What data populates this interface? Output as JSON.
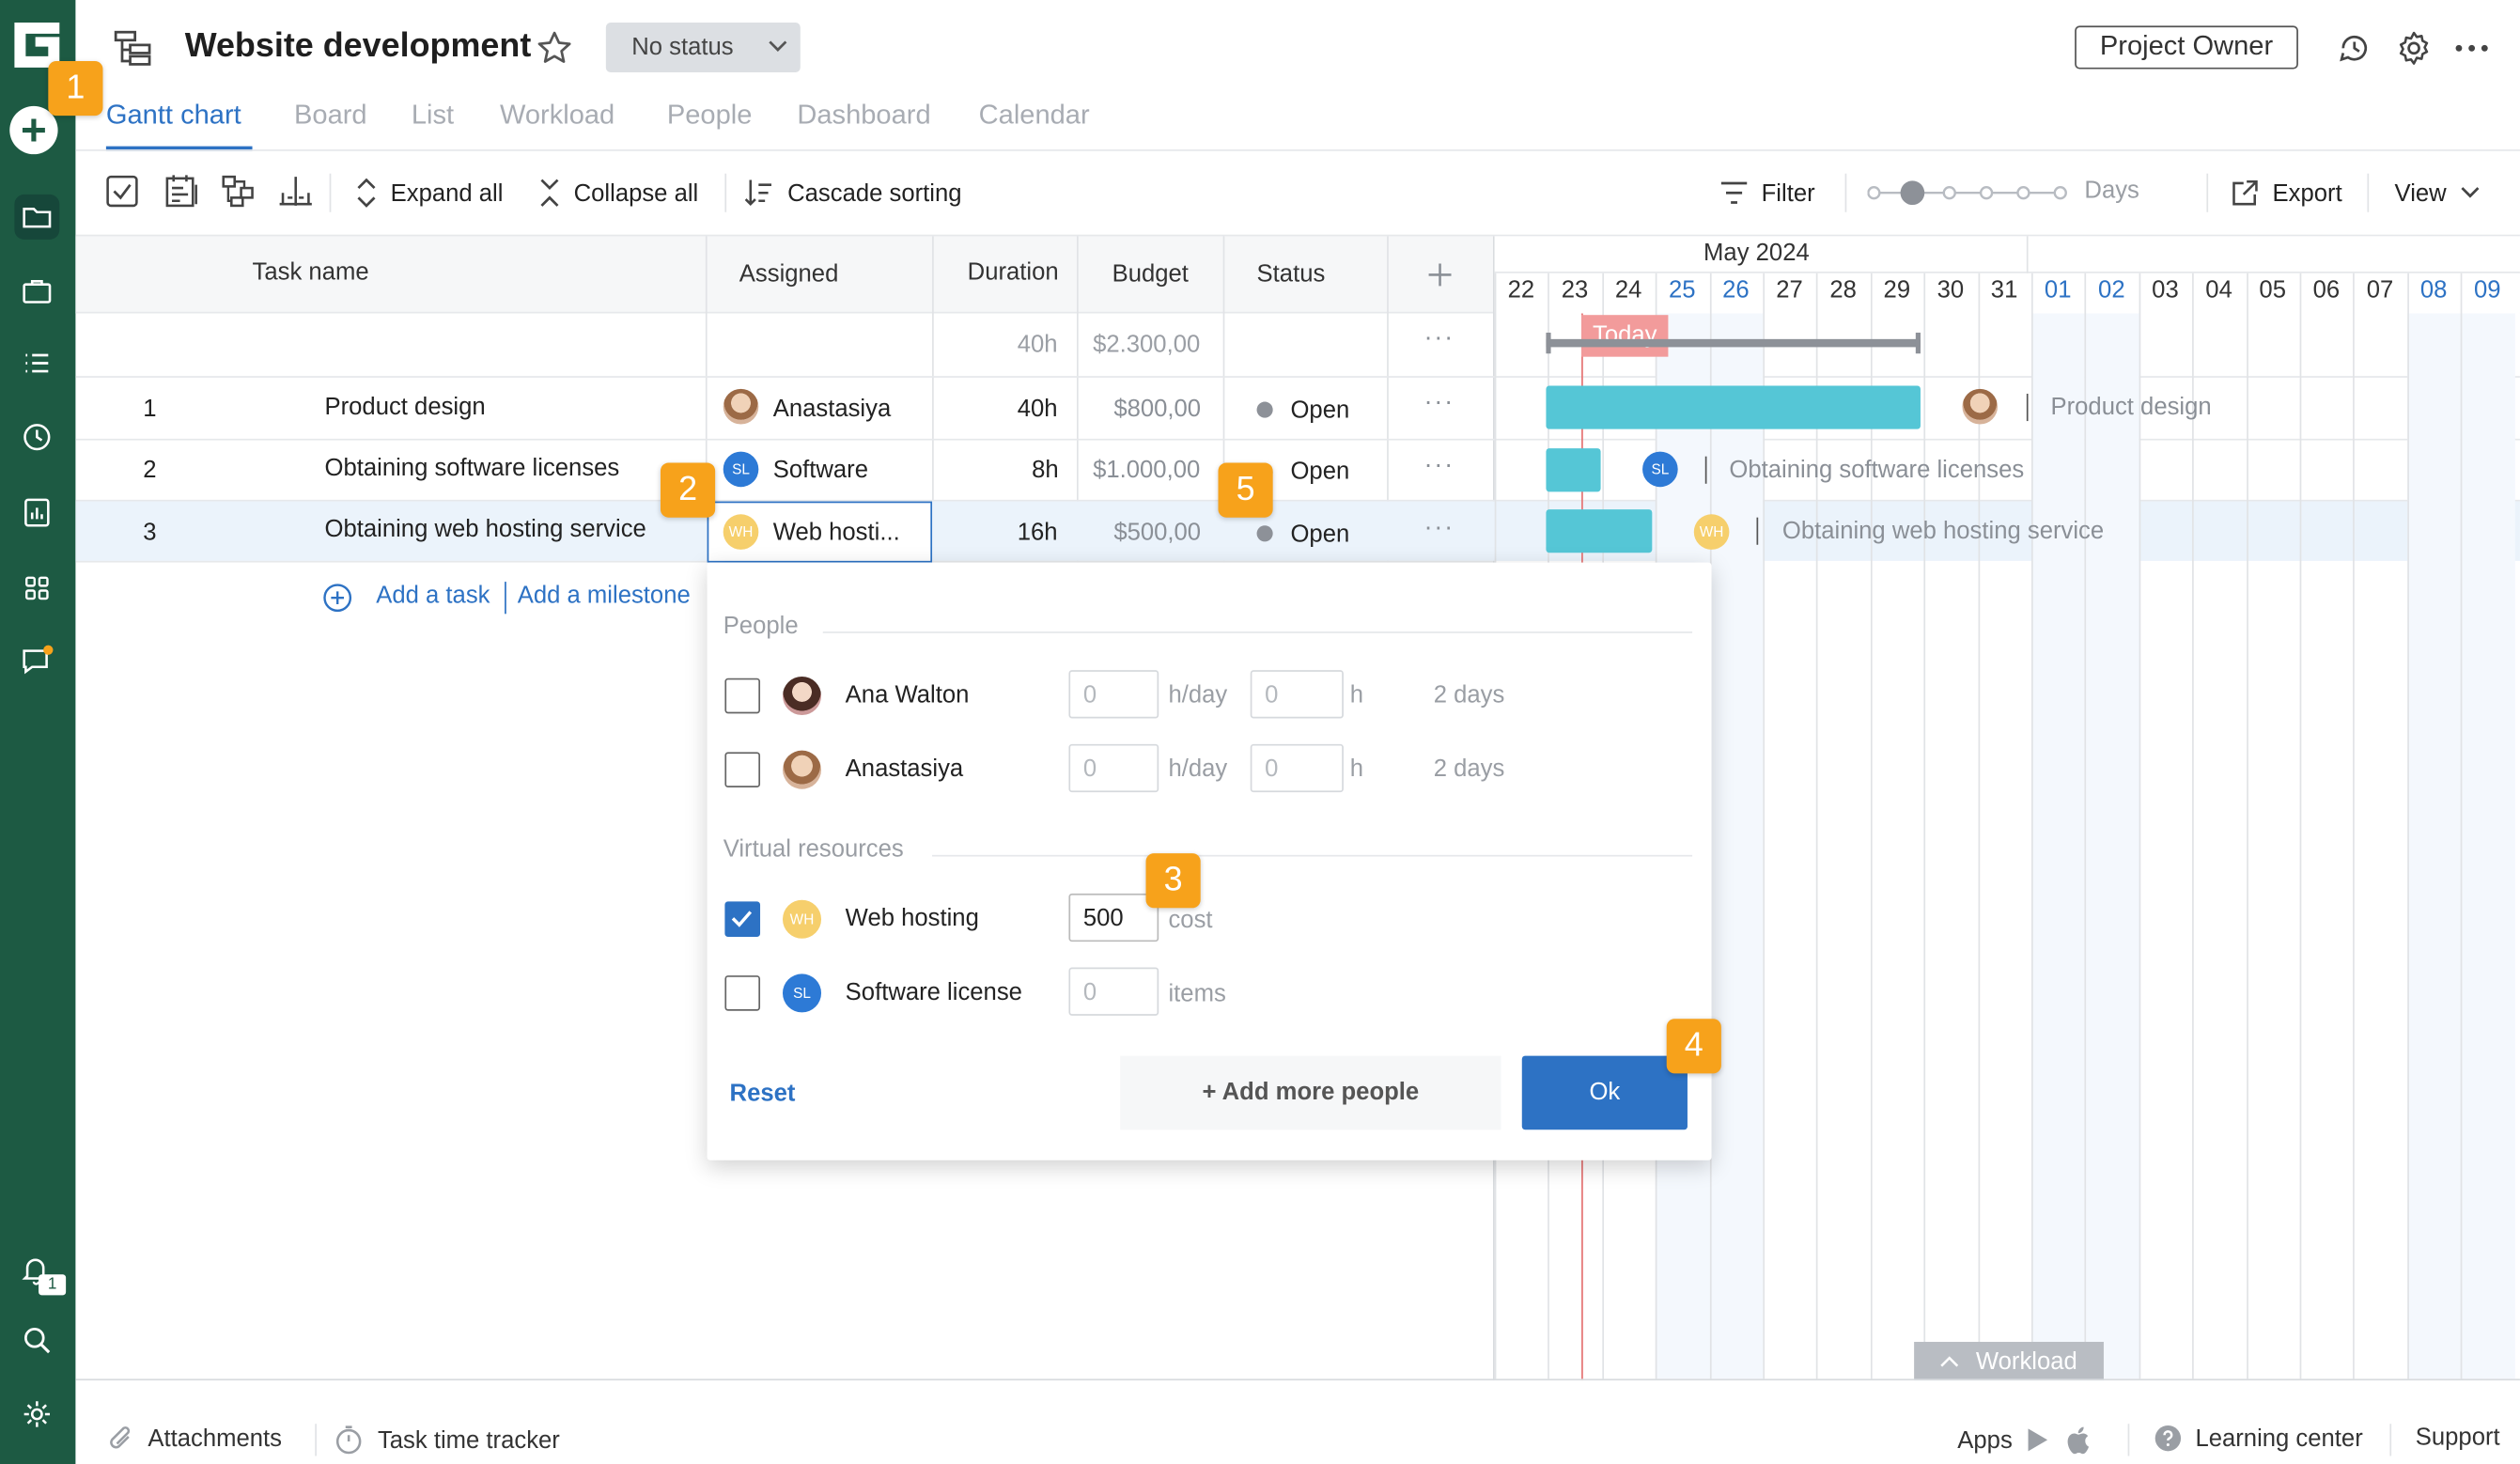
{
  "header": {
    "project_title": "Website development",
    "status_select": "No status",
    "role_button": "Project Owner"
  },
  "tabs": [
    "Gantt chart",
    "Board",
    "List",
    "Workload",
    "People",
    "Dashboard",
    "Calendar"
  ],
  "active_tab": "Gantt chart",
  "toolbar": {
    "expand_all": "Expand all",
    "collapse_all": "Collapse all",
    "cascade_sorting": "Cascade sorting",
    "filter": "Filter",
    "zoom_label": "Days",
    "export": "Export",
    "view": "View"
  },
  "grid": {
    "columns": {
      "task_name": "Task name",
      "assigned": "Assigned",
      "duration": "Duration",
      "budget": "Budget",
      "status": "Status"
    },
    "summary": {
      "duration": "40h",
      "budget": "$2.300,00"
    },
    "rows": [
      {
        "num": "1",
        "name": "Product design",
        "assigned": "Anastasiya",
        "duration": "40h",
        "budget": "$800,00",
        "status": "Open"
      },
      {
        "num": "2",
        "name": "Obtaining software licenses",
        "assigned": "Software",
        "duration": "8h",
        "budget": "$1.000,00",
        "status": "Open"
      },
      {
        "num": "3",
        "name": "Obtaining web hosting service",
        "assigned": "Web hosti...",
        "duration": "16h",
        "budget": "$500,00",
        "status": "Open"
      }
    ],
    "add_task": "Add a task",
    "add_milestone": "Add a milestone"
  },
  "gantt": {
    "month": "May 2024",
    "days": [
      {
        "d": "22",
        "weekend": false
      },
      {
        "d": "23",
        "weekend": false
      },
      {
        "d": "24",
        "weekend": false
      },
      {
        "d": "25",
        "weekend": true
      },
      {
        "d": "26",
        "weekend": true
      },
      {
        "d": "27",
        "weekend": false
      },
      {
        "d": "28",
        "weekend": false
      },
      {
        "d": "29",
        "weekend": false
      },
      {
        "d": "30",
        "weekend": false
      },
      {
        "d": "31",
        "weekend": false
      },
      {
        "d": "01",
        "weekend": true
      },
      {
        "d": "02",
        "weekend": true
      },
      {
        "d": "03",
        "weekend": false
      },
      {
        "d": "04",
        "weekend": false
      },
      {
        "d": "05",
        "weekend": false
      },
      {
        "d": "06",
        "weekend": false
      },
      {
        "d": "07",
        "weekend": false
      },
      {
        "d": "08",
        "weekend": true
      },
      {
        "d": "09",
        "weekend": true
      }
    ],
    "today_label": "Today",
    "bar_labels": [
      "Product design",
      "Obtaining software licenses",
      "Obtaining web hosting service"
    ],
    "workload_toggle": "Workload"
  },
  "popup": {
    "people_section": "People",
    "people": [
      {
        "name": "Ana Walton",
        "hday": "0",
        "h": "0",
        "hday_unit": "h/day",
        "h_unit": "h",
        "days": "2 days",
        "checked": false
      },
      {
        "name": "Anastasiya",
        "hday": "0",
        "h": "0",
        "hday_unit": "h/day",
        "h_unit": "h",
        "days": "2 days",
        "checked": false
      }
    ],
    "virtual_section": "Virtual resources",
    "virtual": [
      {
        "name": "Web hosting",
        "value": "500",
        "unit": "cost",
        "checked": true,
        "initials": "WH"
      },
      {
        "name": "Software license",
        "value": "0",
        "unit": "items",
        "checked": false,
        "initials": "SL"
      }
    ],
    "reset": "Reset",
    "add_more": "+ Add more people",
    "ok": "Ok"
  },
  "badges": [
    "1",
    "2",
    "3",
    "4",
    "5"
  ],
  "avatar_initials": {
    "software": "SL",
    "web_hosting": "WH"
  },
  "footer": {
    "attachments": "Attachments",
    "time_tracker": "Task time tracker",
    "apps": "Apps",
    "learning_center": "Learning center",
    "support": "Support"
  },
  "notification_count": "1",
  "colors": {
    "sidebar": "#1d5a43",
    "accent": "#2d72c4",
    "bar": "#55c6d6",
    "badge": "#f7a21b",
    "today": "#f29b9b"
  }
}
